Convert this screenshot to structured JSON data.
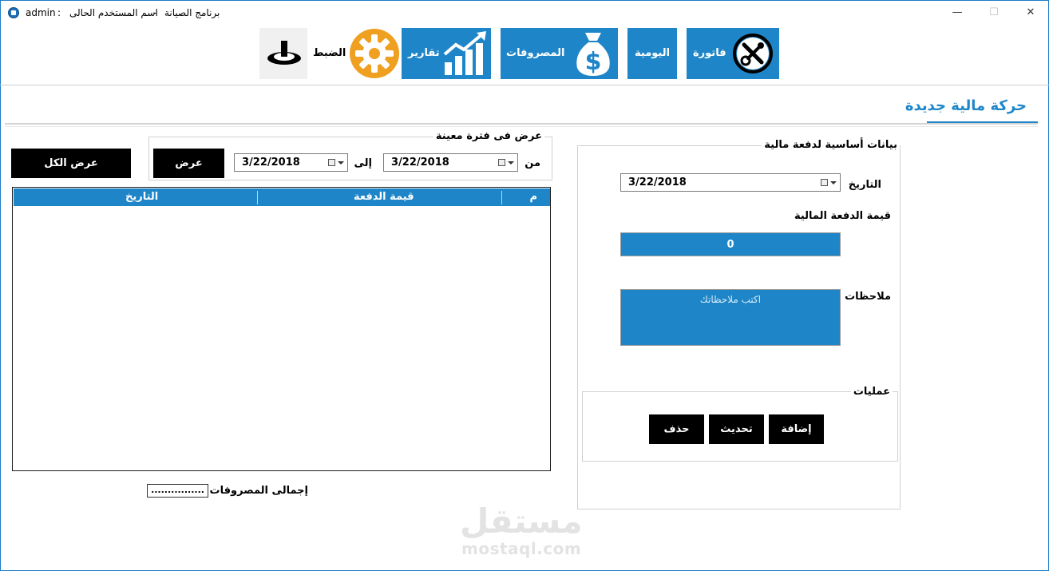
{
  "window": {
    "title_app": "برنامج الصيانة",
    "title_dash": "-",
    "title_user_label": "اسم المستخدم الحالى",
    "title_colon": ":",
    "title_user": "admin",
    "minimize": "—",
    "maximize": "☐",
    "close": "✕"
  },
  "toolbar": {
    "invoice": "فاتورة",
    "daily": "اليومية",
    "expenses": "المصروفات",
    "reports": "تقارير",
    "settings": "الضبط",
    "accent_color": "#1e86c8",
    "settings_icon_color": "#f0a020"
  },
  "page": {
    "title": "حركة مالية جديدة"
  },
  "form": {
    "group_title": "بيانات أساسية لدفعة مالية",
    "date_label": "التاريخ",
    "date_value": "3/22/2018",
    "amount_label": "قيمة الدفعة المالية",
    "amount_value": "0",
    "notes_label": "ملاحظات",
    "notes_placeholder": "اكتب ملاحظاتك",
    "ops_title": "عمليات",
    "add": "إضافة",
    "update": "تحديث",
    "delete": "حذف"
  },
  "filter": {
    "group_title": "عرض فى فترة معينة",
    "from_label": "من",
    "from_value": "3/22/2018",
    "to_label": "إلى",
    "to_value": "3/22/2018",
    "show": "عرض",
    "show_all": "عرض الكل"
  },
  "table": {
    "columns": [
      "م",
      "قيمة الدفعة",
      "التاريخ"
    ],
    "rows": []
  },
  "footer": {
    "total_label": "إجمالى المصروفات",
    "total_value": "................"
  },
  "watermark": {
    "arabic": "مستقل",
    "latin": "mostaql.com"
  }
}
